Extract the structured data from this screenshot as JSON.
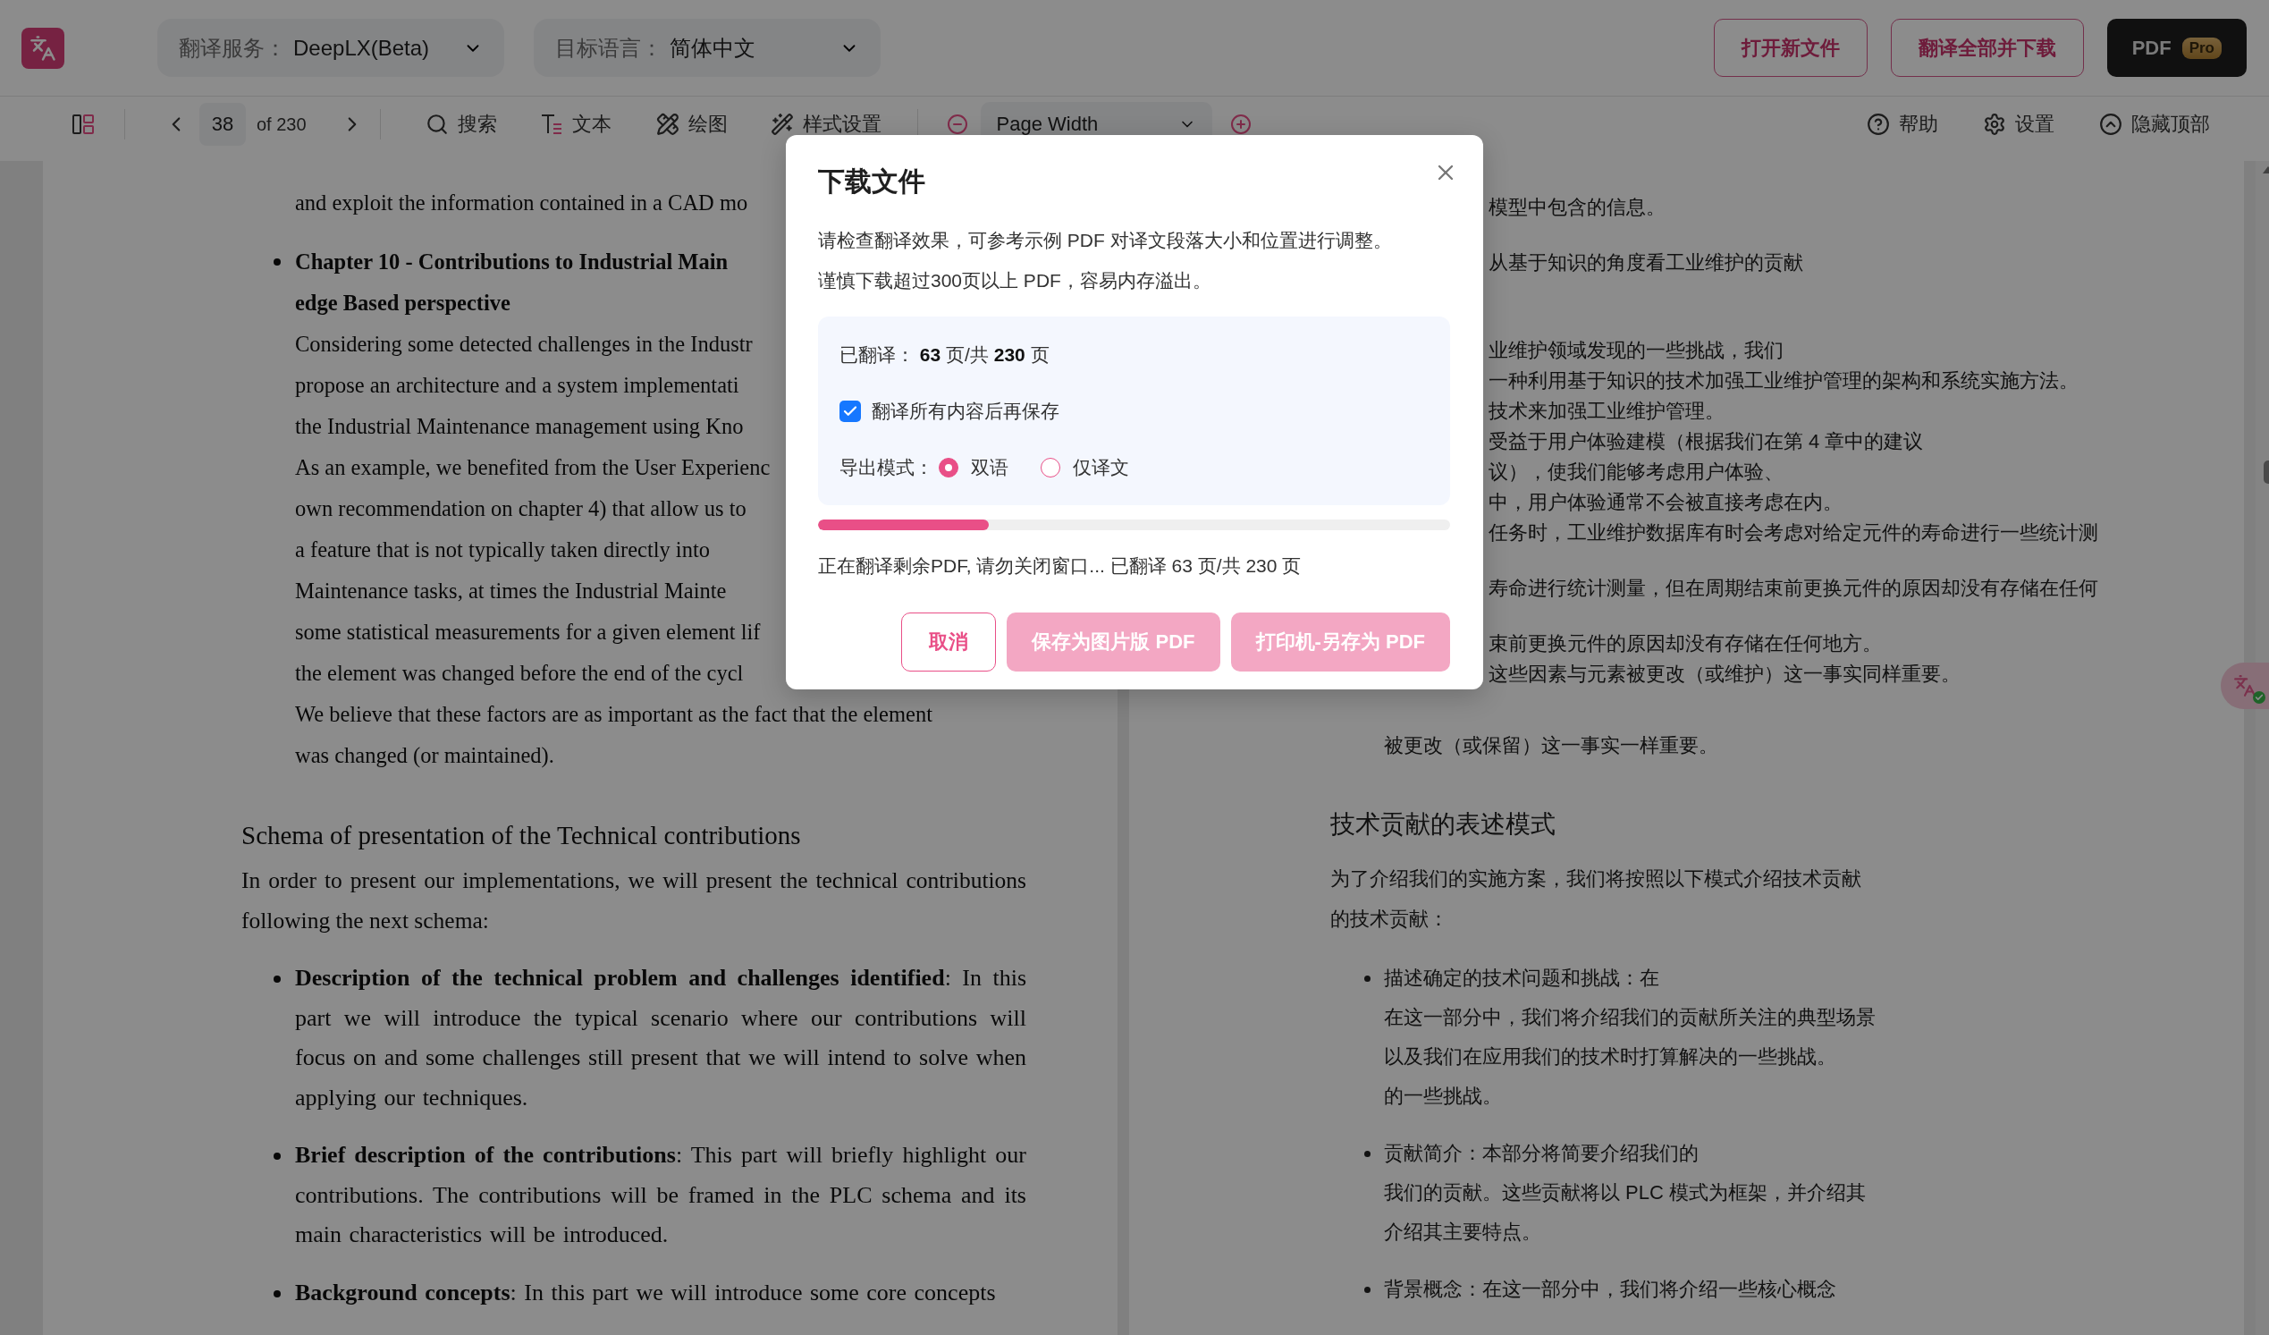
{
  "top_bar": {
    "selects": [
      {
        "label": "翻译服务：",
        "value": "DeepLX(Beta)"
      },
      {
        "label": "目标语言：",
        "value": "简体中文"
      }
    ],
    "buttons": [
      {
        "label": "打开新文件",
        "kind": "outline"
      },
      {
        "label": "翻译全部并下载",
        "kind": "outline"
      },
      {
        "label": "PDF",
        "badge": "Pro",
        "kind": "dark"
      }
    ]
  },
  "toolbar": {
    "page": "38",
    "page_total": "of 230",
    "tools": [
      {
        "label": "搜索"
      },
      {
        "label": "文本"
      },
      {
        "label": "绘图"
      },
      {
        "label": "样式设置"
      }
    ],
    "zoom": "Page Width",
    "right_tools": [
      {
        "label": "帮助"
      },
      {
        "label": "设置"
      },
      {
        "label": "隐藏顶部"
      }
    ]
  },
  "left_page": {
    "top_lines": [
      {
        "text": "and exploit the information contained in a CAD mo",
        "kind": "plain"
      },
      {
        "text": "Chapter 10 - Contributions to Industrial Main",
        "kind": "lead"
      },
      {
        "text": "edge Based perspective",
        "kind": "bold"
      },
      {
        "text": "Considering some detected challenges in the Industr",
        "kind": "plain"
      },
      {
        "text": "propose an architecture and a system implementati",
        "kind": "plain"
      },
      {
        "text": "the Industrial Maintenance management using Kno",
        "kind": "plain"
      },
      {
        "text": "As an example, we benefited from the User Experienc",
        "kind": "plain"
      },
      {
        "text": "own recommendation on chapter 4) that allow us to",
        "kind": "plain"
      },
      {
        "text": "a feature that is not typically taken directly into",
        "kind": "plain"
      },
      {
        "text": "Maintenance tasks, at times the Industrial Mainte",
        "kind": "plain"
      },
      {
        "text": "some statistical measurements for a given element lif",
        "kind": "plain"
      },
      {
        "text": "the element was changed before the end of the cycl",
        "kind": "plain"
      },
      {
        "text": "We believe that these factors are as important as the fact that the element",
        "kind": "plain"
      },
      {
        "text": "was changed (or maintained).",
        "kind": "plain"
      }
    ],
    "heading": "Schema of presentation of the Technical contributions",
    "paragraph": "In order to present our implementations, we will present the technical contributions following the next schema:",
    "bullets": [
      "**Description of the technical problem and challenges identified**: In this part we will introduce the typical scenario where our contributions will focus on and some challenges still present that we will intend to solve when applying our techniques.",
      "**Brief description of the contributions**: This part will briefly highlight our contributions. The contributions will be framed in the PLC schema and its main characteristics will be introduced.",
      "**Background concepts**: In this part we will introduce some core concepts"
    ]
  },
  "right_page": {
    "fragments": [
      [
        "模型中包含的信息。"
      ],
      [
        "从基于知识的角度看工业维护的贡献"
      ],
      [
        "业维护领域发现的一些挑战，我们",
        "一种利用基于知识的技术加强工业维护管理的架构和系统实施方法。",
        "技术来加强工业维护管理。",
        "受益于用户体验建模（根据我们在第 4 章中的建议",
        "议），使我们能够考虑用户体验、",
        "中，用户体验通常不会被直接考虑在内。",
        "任务时，工业维护数据库有时会考虑对给定元件的寿命进行一些统计测"
      ],
      [
        "寿命进行统计测量，但在周期结束前更换元件的原因却没有存储在任何"
      ],
      [
        "束前更换元件的原因却没有存储在任何地方。",
        "这些因素与元素被更改（或维护）这一事实同样重要。"
      ]
    ],
    "tail": "被更改（或保留）这一事实一样重要。",
    "heading": "技术贡献的表述模式",
    "paragraph_lines": [
      "为了介绍我们的实施方案，我们将按照以下模式介绍技术贡献",
      "的技术贡献："
    ],
    "bullets": [
      [
        "描述确定的技术问题和挑战：在",
        "在这一部分中，我们将介绍我们的贡献所关注的典型场景",
        "以及我们在应用我们的技术时打算解决的一些挑战。",
        "的一些挑战。"
      ],
      [
        "贡献简介：本部分将简要介绍我们的",
        "我们的贡献。这些贡献将以 PLC 模式为框架，并介绍其",
        "介绍其主要特点。"
      ],
      [
        "背景概念：在这一部分中，我们将介绍一些核心概念"
      ]
    ]
  },
  "dialog": {
    "title": "下载文件",
    "notes": [
      "请检查翻译效果，可参考示例 PDF 对译文段落大小和位置进行调整。",
      "谨慎下载超过300页以上 PDF，容易内存溢出。"
    ],
    "summary": "已翻译：  **63** 页/共 **230** 页",
    "save_after": {
      "label": "翻译所有内容后再保存",
      "checked": true
    },
    "export_mode": {
      "label": "导出模式：",
      "options": [
        {
          "label": "双语",
          "selected": true
        },
        {
          "label": "仅译文",
          "selected": false
        }
      ]
    },
    "progress": {
      "level": 0.27
    },
    "status": "正在翻译剩余PDF, 请勿关闭窗口... 已翻译 63 页/共 230 页",
    "buttons": [
      {
        "label": "取消",
        "kind": "outline",
        "disabled": false
      },
      {
        "label": "保存为图片版 PDF",
        "kind": "filled",
        "disabled": true
      },
      {
        "label": "打印机-另存为 PDF",
        "kind": "filled",
        "disabled": true
      }
    ]
  }
}
